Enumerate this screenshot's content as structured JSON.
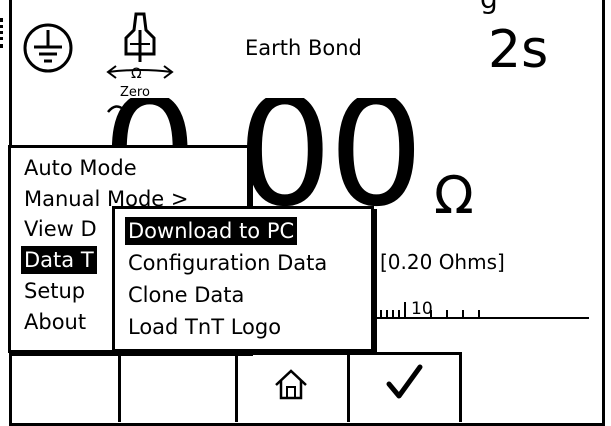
{
  "header": {
    "title": "Earth Bond",
    "timer": "2s",
    "top_cut_text": "g",
    "zero_label": "Zero",
    "zero_omega": "Ω"
  },
  "reading": {
    "value": "0.00",
    "unit": "Ω",
    "limit": "[0.20 Ohms]",
    "scale_label": "10"
  },
  "main_menu": {
    "items": [
      {
        "label": "Auto Mode"
      },
      {
        "label": "Manual Mode >"
      },
      {
        "label": "View D"
      },
      {
        "label": "Data T"
      },
      {
        "label": "Setup"
      },
      {
        "label": "About"
      }
    ],
    "selected": "Data T"
  },
  "submenu": {
    "items": [
      {
        "label": "Download to PC"
      },
      {
        "label": "Configuration Data"
      },
      {
        "label": "Clone Data"
      },
      {
        "label": "Load TnT Logo"
      }
    ],
    "selected": "Download to PC"
  },
  "softkeys": [
    {
      "icon": "none"
    },
    {
      "icon": "none"
    },
    {
      "icon": "home-icon"
    },
    {
      "icon": "checkmark-icon"
    }
  ],
  "colors": {
    "foreground": "#000000",
    "background": "#ffffff"
  }
}
